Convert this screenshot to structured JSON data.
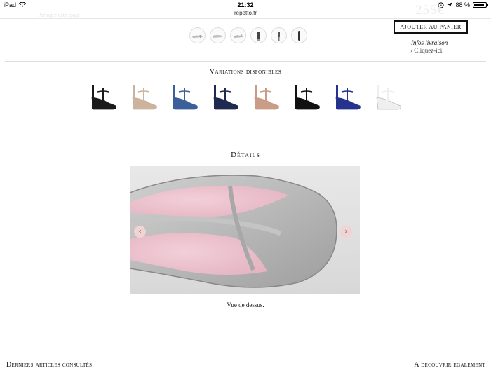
{
  "status_bar": {
    "device": "iPad",
    "time": "21:32",
    "battery": "88 %",
    "battery_level": 0.88
  },
  "browser": {
    "url": "repetto.fr"
  },
  "header": {
    "faded_link": "Partager cette page",
    "faded_price": "255€"
  },
  "product": {
    "add_to_cart": "AJOUTER AU PANIER",
    "delivery_title": "Infos livraison",
    "delivery_link": "Cliquez-ici."
  },
  "variations": {
    "title": "Variations disponibles",
    "items": [
      {
        "name": "black",
        "color": "#1a1a1a"
      },
      {
        "name": "beige",
        "color": "#cbb39d"
      },
      {
        "name": "blue",
        "color": "#3b5f9a"
      },
      {
        "name": "navy",
        "color": "#1e2a4f"
      },
      {
        "name": "nude",
        "color": "#c99c86"
      },
      {
        "name": "black-red",
        "color": "#111111"
      },
      {
        "name": "royal-blue",
        "color": "#25338f"
      },
      {
        "name": "white",
        "color": "#efefef"
      }
    ]
  },
  "details": {
    "title": "Détails",
    "caption": "Vue de dessus."
  },
  "footer": {
    "recent_title": "Derniers articles consultés",
    "discover_title": "A découvrir également"
  }
}
